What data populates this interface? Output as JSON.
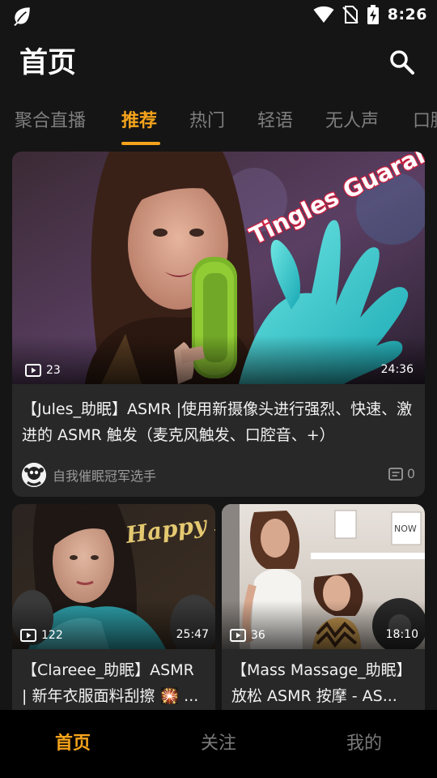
{
  "status": {
    "time": "8:26"
  },
  "header": {
    "title": "首页"
  },
  "tabs": [
    {
      "label": "聚合直播"
    },
    {
      "label": "推荐"
    },
    {
      "label": "热门"
    },
    {
      "label": "轻语"
    },
    {
      "label": "无人声"
    },
    {
      "label": "口腔"
    }
  ],
  "feed": {
    "featured": {
      "plays": "23",
      "duration": "24:36",
      "overlay_text": "Tingles Guaranteed",
      "title": "【Jules_助眠】ASMR |使用新摄像头进行强烈、快速、激进的 ASMR 触发（麦克风触发、口腔音、+）",
      "author": "自我催眠冠军选手",
      "comments": "0"
    },
    "left": {
      "plays": "122",
      "duration": "25:47",
      "overlay_text": "Happy New Year",
      "title": "【Clareee_助眠】ASMR | 新年衣服面料刮擦 🎇 ..."
    },
    "right": {
      "plays": "36",
      "duration": "18:10",
      "poster_text": "NOW",
      "title": "【Mass Massage_助眠】放松 ASMR 按摩 - AS..."
    }
  },
  "bottom_nav": [
    {
      "label": "首页"
    },
    {
      "label": "关注"
    },
    {
      "label": "我的"
    }
  ],
  "colors": {
    "accent": "#f5a31c",
    "background": "#151515",
    "card": "#282828"
  },
  "icons": [
    "leaf-icon",
    "wifi-icon",
    "no-sim-icon",
    "battery-charging-icon",
    "search-icon",
    "play-icon",
    "comment-icon"
  ]
}
